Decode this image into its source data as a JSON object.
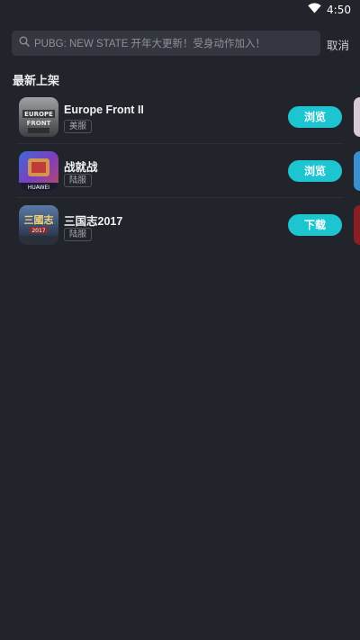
{
  "status_bar": {
    "time": "4:50",
    "wifi_icon": "wifi-icon"
  },
  "search": {
    "placeholder": "PUBG: NEW STATE 开年大更新！受身动作加入！",
    "cancel_label": "取消",
    "icon": "search-icon"
  },
  "section": {
    "title": "最新上架"
  },
  "apps": [
    {
      "name": "Europe Front II",
      "tag": "美服",
      "action": "浏览",
      "icon_text": "EUROPE FRONT",
      "color": "#5b5f63"
    },
    {
      "name": "战就战",
      "tag": "陆服",
      "action": "浏览",
      "icon_text": "HUAWEI",
      "color": "#4a3a8c"
    },
    {
      "name": "三国志2017",
      "tag": "陆服",
      "action": "下载",
      "icon_text": "三國志 2017",
      "color": "#2f3a56"
    }
  ],
  "colors": {
    "background": "#22242b",
    "accent": "#1dc5d0",
    "search_bg": "#34373f"
  }
}
